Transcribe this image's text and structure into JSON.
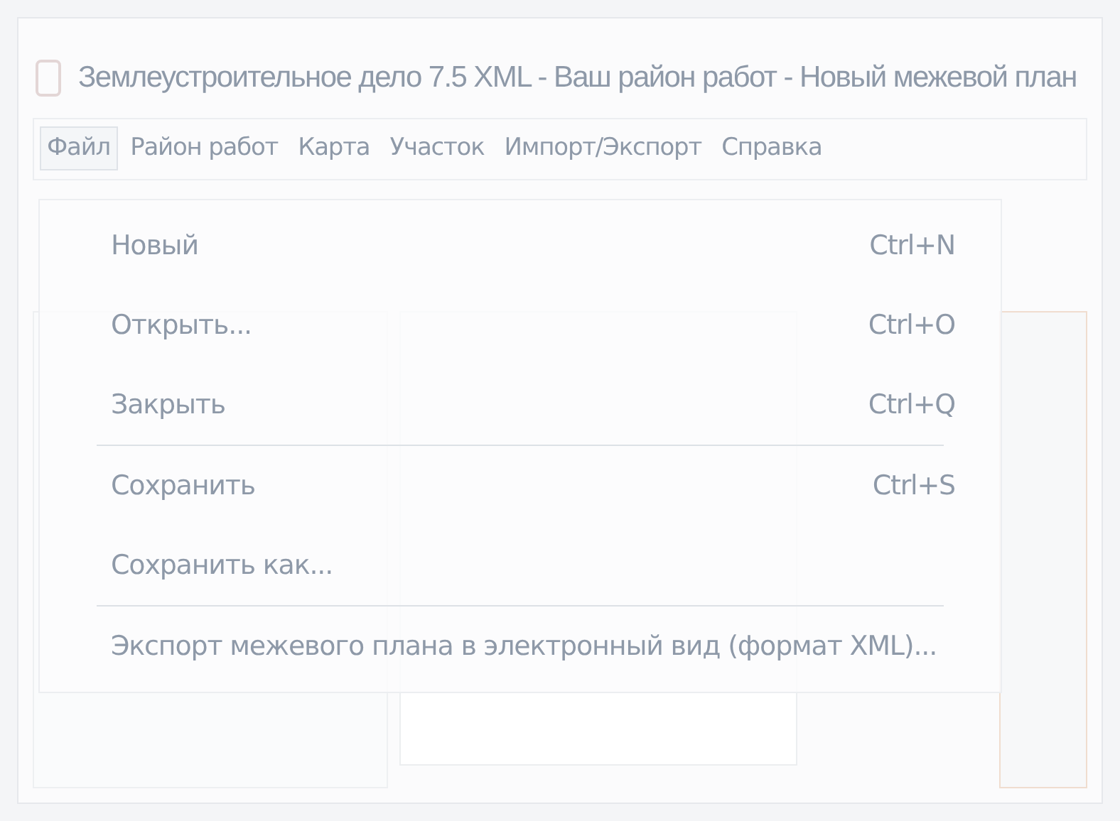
{
  "window": {
    "title": "Землеустроительное дело 7.5 XML - Ваш район работ - Новый межевой план"
  },
  "menu_bar": [
    {
      "label": "Файл",
      "selected": true
    },
    {
      "label": "Район работ",
      "selected": false
    },
    {
      "label": "Карта",
      "selected": false
    },
    {
      "label": "Участок",
      "selected": false
    },
    {
      "label": "Импорт/Экспорт",
      "selected": false
    },
    {
      "label": "Справка",
      "selected": false
    }
  ],
  "file_menu": [
    {
      "label": "Новый",
      "shortcut": "Ctrl+N",
      "separator_before": false
    },
    {
      "label": "Открыть...",
      "shortcut": "Ctrl+O",
      "separator_before": false
    },
    {
      "label": "Закрыть",
      "shortcut": "Ctrl+Q",
      "separator_before": false
    },
    {
      "label": "Сохранить",
      "shortcut": "Ctrl+S",
      "separator_before": true
    },
    {
      "label": "Сохранить как...",
      "separator_before": false
    },
    {
      "label": "Экспорт межевого плана в электронный вид (формат XML)...",
      "separator_before": true
    }
  ]
}
